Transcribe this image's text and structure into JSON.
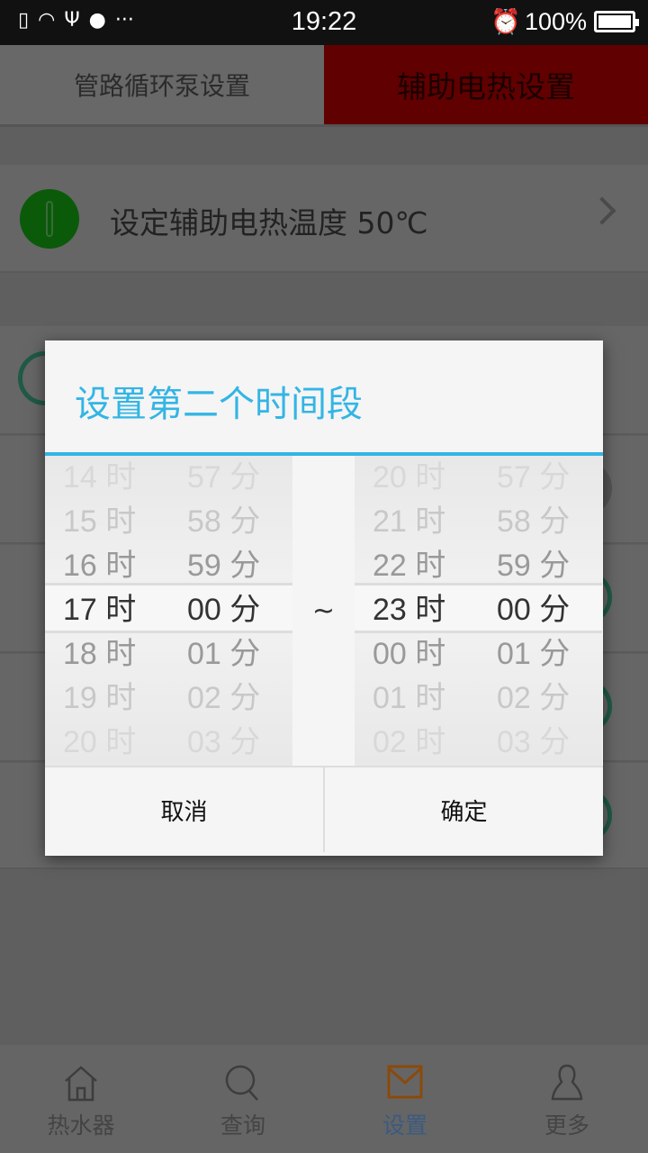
{
  "status_bar": {
    "time": "19:22",
    "battery": "100%",
    "icons": [
      "sim-missing-icon",
      "wifi-icon",
      "usb-icon",
      "android-icon",
      "more-dots-icon",
      "alarm-icon",
      "battery-icon"
    ]
  },
  "tabs": [
    {
      "label": "管路循环泵设置",
      "active": false
    },
    {
      "label": "辅助电热设置",
      "active": true
    }
  ],
  "temp_row": {
    "label": "设定辅助电热温度  50℃",
    "icon": "thermometer-icon"
  },
  "dialog": {
    "title": "设置第二个时间段",
    "separator": "~",
    "start": {
      "hours": [
        "14 时",
        "15 时",
        "16 时",
        "17 时",
        "18 时",
        "19 时",
        "20 时"
      ],
      "minutes": [
        "57 分",
        "58 分",
        "59 分",
        "00 分",
        "01 分",
        "02 分",
        "03 分"
      ],
      "selected_hour": "17 时",
      "selected_minute": "00 分"
    },
    "end": {
      "hours": [
        "20 时",
        "21 时",
        "22 时",
        "23 时",
        "00 时",
        "01 时",
        "02 时"
      ],
      "minutes": [
        "57 分",
        "58 分",
        "59 分",
        "00 分",
        "01 分",
        "02 分",
        "03 分"
      ],
      "selected_hour": "23 时",
      "selected_minute": "00 分"
    },
    "cancel_label": "取消",
    "confirm_label": "确定",
    "accent_color": "#33b5e5"
  },
  "bottom_nav": [
    {
      "label": "热水器",
      "icon": "home-icon"
    },
    {
      "label": "查询",
      "icon": "search-icon"
    },
    {
      "label": "设置",
      "icon": "mail-icon",
      "active": true
    },
    {
      "label": "更多",
      "icon": "person-icon"
    }
  ]
}
